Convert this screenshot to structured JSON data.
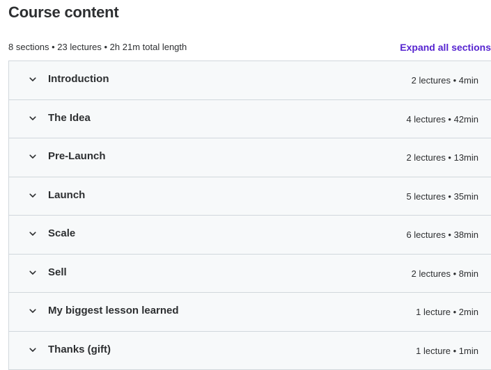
{
  "header": {
    "title": "Course content",
    "summary": "8 sections • 23 lectures • 2h 21m total length",
    "expand_label": "Expand all sections"
  },
  "sections": [
    {
      "title": "Introduction",
      "meta": "2 lectures • 4min",
      "icon": "chevron-down-icon"
    },
    {
      "title": "The Idea",
      "meta": "4 lectures • 42min",
      "icon": "chevron-down-icon"
    },
    {
      "title": "Pre-Launch",
      "meta": "2 lectures • 13min",
      "icon": "chevron-down-icon"
    },
    {
      "title": "Launch",
      "meta": "5 lectures • 35min",
      "icon": "chevron-down-icon"
    },
    {
      "title": "Scale",
      "meta": "6 lectures • 38min",
      "icon": "chevron-down-icon"
    },
    {
      "title": "Sell",
      "meta": "2 lectures • 8min",
      "icon": "chevron-down-icon"
    },
    {
      "title": "My biggest lesson learned",
      "meta": "1 lecture • 2min",
      "icon": "chevron-down-icon"
    },
    {
      "title": "Thanks (gift)",
      "meta": "1 lecture • 1min",
      "icon": "chevron-down-icon"
    }
  ],
  "colors": {
    "accent": "#5624d0",
    "row_background": "#f7f9fa",
    "border": "#d1d7dc",
    "text": "#2d2f31"
  }
}
